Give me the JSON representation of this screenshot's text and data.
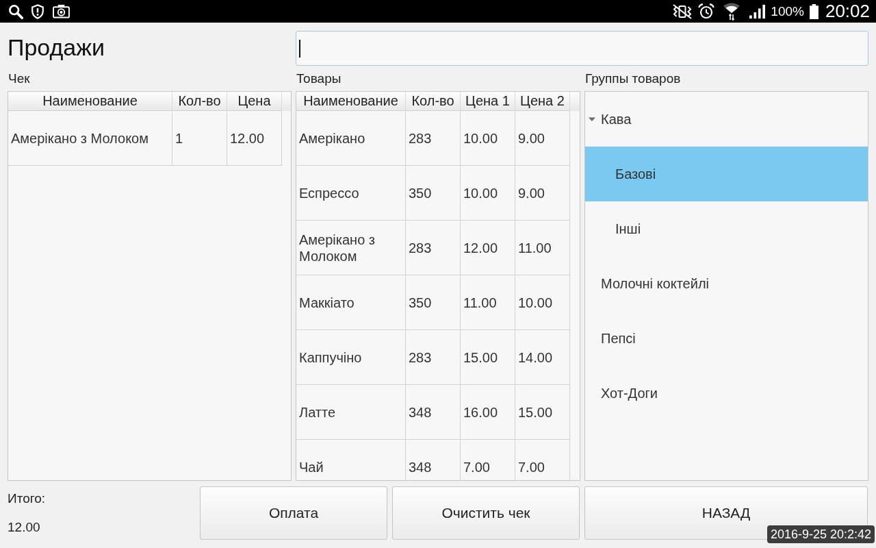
{
  "status_bar": {
    "battery": "100%",
    "time": "20:02"
  },
  "title": "Продажи",
  "search": {
    "focused": true
  },
  "receipt": {
    "label": "Чек",
    "columns": [
      "Наименование",
      "Кол-во",
      "Цена"
    ],
    "rows": [
      [
        "Амерікано з Молоком",
        "1",
        "12.00"
      ]
    ]
  },
  "products": {
    "label": "Товары",
    "columns": [
      "Наименование",
      "Кол-во",
      "Цена 1",
      "Цена 2"
    ],
    "rows": [
      [
        "Амерікано",
        "283",
        "10.00",
        "9.00"
      ],
      [
        "Еспрессо",
        "350",
        "10.00",
        "9.00"
      ],
      [
        "Амерікано з Молоком",
        "283",
        "12.00",
        "11.00"
      ],
      [
        "Маккіато",
        "350",
        "11.00",
        "10.00"
      ],
      [
        "Каппучіно",
        "283",
        "15.00",
        "14.00"
      ],
      [
        "Латте",
        "348",
        "16.00",
        "15.00"
      ],
      [
        "Чай",
        "348",
        "7.00",
        "7.00"
      ]
    ]
  },
  "groups": {
    "label": "Группы товаров",
    "items": [
      {
        "label": "Кава",
        "selected": false,
        "expanded": true,
        "children": [
          {
            "label": "Базові",
            "selected": true
          },
          {
            "label": "Інші",
            "selected": false
          }
        ]
      },
      {
        "label": "Молочні коктейлі",
        "selected": false
      },
      {
        "label": "Пепсі",
        "selected": false
      },
      {
        "label": "Хот-Доги",
        "selected": false
      }
    ]
  },
  "total": {
    "label": "Итого:",
    "value": "12.00"
  },
  "buttons": [
    {
      "label": "Оплата"
    },
    {
      "label": "Очистить чек"
    },
    {
      "label": "НАЗАД"
    }
  ],
  "timestamp_overlay": "2016-9-25 20:2:42"
}
